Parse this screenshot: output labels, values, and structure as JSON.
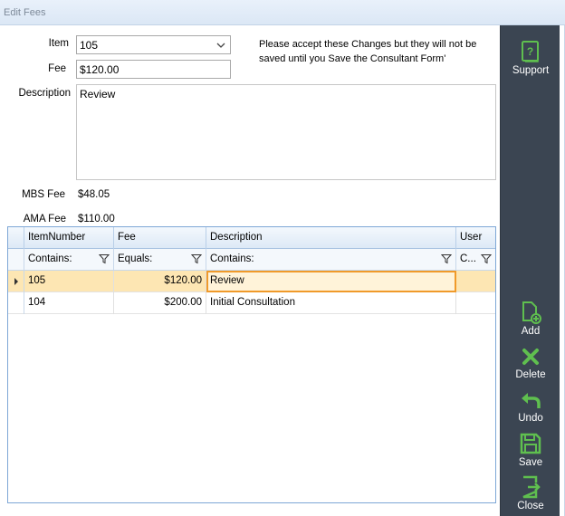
{
  "window": {
    "title": "Edit Fees"
  },
  "form": {
    "item_label": "Item",
    "item_value": "105",
    "fee_label": "Fee",
    "fee_value": "$120.00",
    "description_label": "Description",
    "description_value": "Review",
    "note": "Please accept these Changes but they will not be saved until you Save the Consultant Form'",
    "mbs_label": "MBS Fee",
    "mbs_value": "$48.05",
    "ama_label": "AMA Fee",
    "ama_value": "$110.00"
  },
  "grid": {
    "columns": [
      "ItemNumber",
      "Fee",
      "Description",
      "User"
    ],
    "filters": [
      "Contains:",
      "Equals:",
      "Contains:",
      "C..."
    ],
    "rows": [
      {
        "item": "105",
        "fee": "$120.00",
        "description": "Review",
        "user": "",
        "selected": true
      },
      {
        "item": "104",
        "fee": "$200.00",
        "description": "Initial Consultation",
        "user": "",
        "selected": false
      }
    ]
  },
  "sidebar": {
    "support_label": "Support",
    "add_label": "Add",
    "delete_label": "Delete",
    "undo_label": "Undo",
    "save_label": "Save",
    "close_label": "Close"
  },
  "colors": {
    "sidebar_bg": "#3b4552",
    "icon_green": "#5fbf4f",
    "selected_row": "#fde6b3",
    "active_cell_border": "#f09a2a"
  }
}
